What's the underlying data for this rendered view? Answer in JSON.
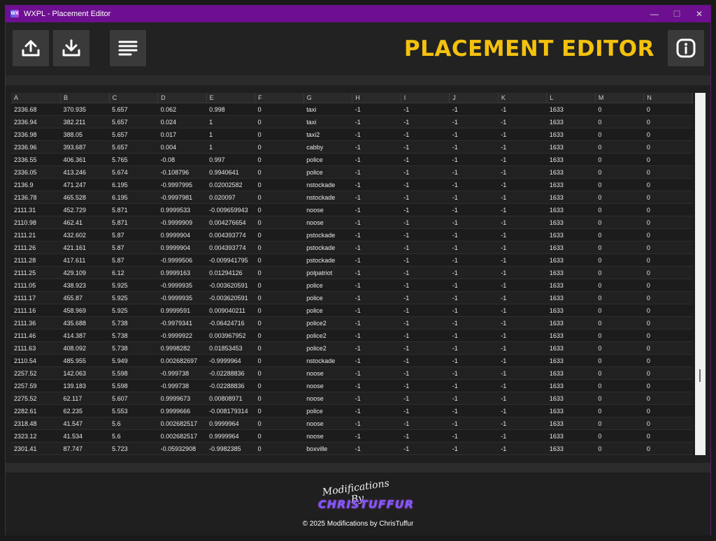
{
  "window": {
    "app_icon": "WX",
    "title": "WXPL - Placement Editor",
    "minimize": "—",
    "maximize": "☐",
    "close": "✕"
  },
  "toolbar": {
    "heading": "PLACEMENT EDITOR",
    "buttons": [
      "upload-icon",
      "download-icon",
      "menu-icon",
      "info-icon"
    ]
  },
  "grid": {
    "columns": [
      "A",
      "B",
      "C",
      "D",
      "E",
      "F",
      "G",
      "H",
      "I",
      "J",
      "K",
      "L",
      "M",
      "N"
    ],
    "rows": [
      [
        "2336.68",
        "370.935",
        "5.657",
        "0.062",
        "0.998",
        "0",
        "taxi",
        "-1",
        "-1",
        "-1",
        "-1",
        "1633",
        "0",
        "0"
      ],
      [
        "2336.94",
        "382.211",
        "5.657",
        "0.024",
        "1",
        "0",
        "taxi",
        "-1",
        "-1",
        "-1",
        "-1",
        "1633",
        "0",
        "0"
      ],
      [
        "2336.98",
        "388.05",
        "5.657",
        "0.017",
        "1",
        "0",
        "taxi2",
        "-1",
        "-1",
        "-1",
        "-1",
        "1633",
        "0",
        "0"
      ],
      [
        "2336.96",
        "393.687",
        "5.657",
        "0.004",
        "1",
        "0",
        "cabby",
        "-1",
        "-1",
        "-1",
        "-1",
        "1633",
        "0",
        "0"
      ],
      [
        "2336.55",
        "406.361",
        "5.765",
        "-0.08",
        "0.997",
        "0",
        "police",
        "-1",
        "-1",
        "-1",
        "-1",
        "1633",
        "0",
        "0"
      ],
      [
        "2336.05",
        "413.246",
        "5.674",
        "-0.108796",
        "0.9940641",
        "0",
        "police",
        "-1",
        "-1",
        "-1",
        "-1",
        "1633",
        "0",
        "0"
      ],
      [
        "2136.9",
        "471.247",
        "6.195",
        "-0.9997995",
        "0.02002582",
        "0",
        "nstockade",
        "-1",
        "-1",
        "-1",
        "-1",
        "1633",
        "0",
        "0"
      ],
      [
        "2136.78",
        "465.528",
        "6.195",
        "-0.9997981",
        "0.020097",
        "0",
        "nstockade",
        "-1",
        "-1",
        "-1",
        "-1",
        "1633",
        "0",
        "0"
      ],
      [
        "2111.31",
        "452.729",
        "5.871",
        "0.9999533",
        "-0.009659943",
        "0",
        "noose",
        "-1",
        "-1",
        "-1",
        "-1",
        "1633",
        "0",
        "0"
      ],
      [
        "2110.98",
        "462.41",
        "5.871",
        "-0.9999909",
        "0.004276654",
        "0",
        "noose",
        "-1",
        "-1",
        "-1",
        "-1",
        "1633",
        "0",
        "0"
      ],
      [
        "2111.21",
        "432.602",
        "5.87",
        "0.9999904",
        "0.004393774",
        "0",
        "pstockade",
        "-1",
        "-1",
        "-1",
        "-1",
        "1633",
        "0",
        "0"
      ],
      [
        "2111.26",
        "421.161",
        "5.87",
        "0.9999904",
        "0.004393774",
        "0",
        "pstockade",
        "-1",
        "-1",
        "-1",
        "-1",
        "1633",
        "0",
        "0"
      ],
      [
        "2111.28",
        "417.611",
        "5.87",
        "-0.9999506",
        "-0.009941795",
        "0",
        "pstockade",
        "-1",
        "-1",
        "-1",
        "-1",
        "1633",
        "0",
        "0"
      ],
      [
        "2111.25",
        "429.109",
        "6.12",
        "0.9999163",
        "0.01294126",
        "0",
        "polpatriot",
        "-1",
        "-1",
        "-1",
        "-1",
        "1633",
        "0",
        "0"
      ],
      [
        "2111.05",
        "438.923",
        "5.925",
        "-0.9999935",
        "-0.003620591",
        "0",
        "police",
        "-1",
        "-1",
        "-1",
        "-1",
        "1633",
        "0",
        "0"
      ],
      [
        "2111.17",
        "455.87",
        "5.925",
        "-0.9999935",
        "-0.003620591",
        "0",
        "police",
        "-1",
        "-1",
        "-1",
        "-1",
        "1633",
        "0",
        "0"
      ],
      [
        "2111.16",
        "458.969",
        "5.925",
        "0.9999591",
        "0.009040211",
        "0",
        "police",
        "-1",
        "-1",
        "-1",
        "-1",
        "1633",
        "0",
        "0"
      ],
      [
        "2111.36",
        "435.688",
        "5.738",
        "-0.9979341",
        "-0.06424716",
        "0",
        "police2",
        "-1",
        "-1",
        "-1",
        "-1",
        "1633",
        "0",
        "0"
      ],
      [
        "2111.46",
        "414.387",
        "5.738",
        "-0.9999922",
        "0.003967952",
        "0",
        "police2",
        "-1",
        "-1",
        "-1",
        "-1",
        "1633",
        "0",
        "0"
      ],
      [
        "2111.63",
        "408.092",
        "5.738",
        "0.9998282",
        "0.01853453",
        "0",
        "police2",
        "-1",
        "-1",
        "-1",
        "-1",
        "1633",
        "0",
        "0"
      ],
      [
        "2110.54",
        "485.955",
        "5.949",
        "0.002682697",
        "-0.9999964",
        "0",
        "nstockade",
        "-1",
        "-1",
        "-1",
        "-1",
        "1633",
        "0",
        "0"
      ],
      [
        "2257.52",
        "142.063",
        "5.598",
        "-0.999738",
        "-0.02288836",
        "0",
        "noose",
        "-1",
        "-1",
        "-1",
        "-1",
        "1633",
        "0",
        "0"
      ],
      [
        "2257.59",
        "139.183",
        "5.598",
        "-0.999738",
        "-0.02288836",
        "0",
        "noose",
        "-1",
        "-1",
        "-1",
        "-1",
        "1633",
        "0",
        "0"
      ],
      [
        "2275.52",
        "62.117",
        "5.607",
        "0.9999673",
        "0.00808971",
        "0",
        "noose",
        "-1",
        "-1",
        "-1",
        "-1",
        "1633",
        "0",
        "0"
      ],
      [
        "2282.61",
        "62.235",
        "5.553",
        "0.9999666",
        "-0.008179314",
        "0",
        "police",
        "-1",
        "-1",
        "-1",
        "-1",
        "1633",
        "0",
        "0"
      ],
      [
        "2318.48",
        "41.547",
        "5.6",
        "0.002682517",
        "0.9999964",
        "0",
        "noose",
        "-1",
        "-1",
        "-1",
        "-1",
        "1633",
        "0",
        "0"
      ],
      [
        "2323.12",
        "41.534",
        "5.6",
        "0.002682517",
        "0.9999964",
        "0",
        "noose",
        "-1",
        "-1",
        "-1",
        "-1",
        "1633",
        "0",
        "0"
      ],
      [
        "2301.41",
        "87.747",
        "5.723",
        "-0.05932908",
        "-0.9982385",
        "0",
        "boxville",
        "-1",
        "-1",
        "-1",
        "-1",
        "1633",
        "0",
        "0"
      ]
    ]
  },
  "footer": {
    "logo_script": "Modifications By",
    "logo_brand": "CHRISTUFFUR",
    "copyright": "© 2025 Modifications by ChrisTuffur"
  },
  "colors": {
    "titlebar": "#6e0f91",
    "heading": "#f4c20d",
    "button": "#3a3a3a",
    "background": "#1f1f1f"
  }
}
